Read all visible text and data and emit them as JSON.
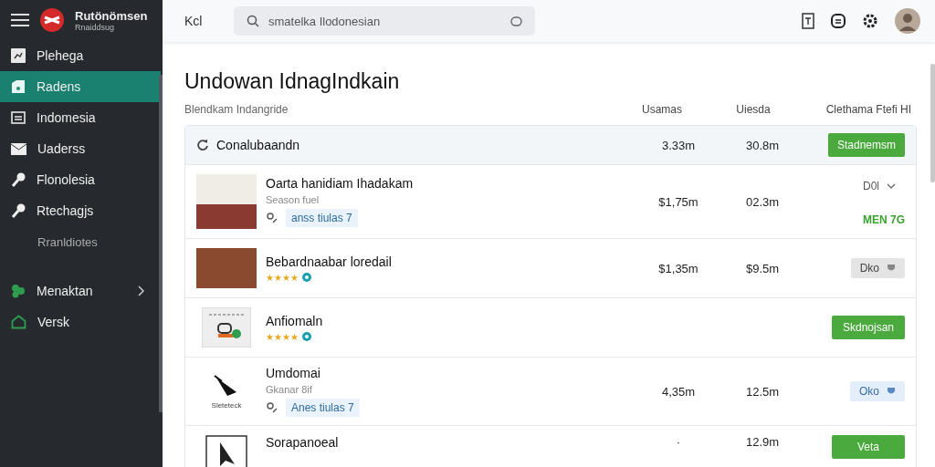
{
  "brand": {
    "name": "Rutönömsen",
    "subtitle": "Rnaiddsug"
  },
  "sidebar": {
    "items": [
      {
        "label": "Plehega",
        "selected": false
      },
      {
        "label": "Radens",
        "selected": true
      },
      {
        "label": "Indomesia",
        "selected": false
      },
      {
        "label": "Uaderss",
        "selected": false
      },
      {
        "label": "Flonolesia",
        "selected": false
      },
      {
        "label": "Rtechagjs",
        "selected": false
      },
      {
        "label": "Rranldiotes",
        "selected": false
      },
      {
        "label": "Menaktan",
        "selected": false,
        "expanded": false
      },
      {
        "label": "Versk",
        "selected": false
      }
    ]
  },
  "topbar": {
    "label": "Kcl",
    "search": {
      "placeholder": "smatelka Ilodonesian"
    }
  },
  "page": {
    "title": "Undowan IdnagIndkain",
    "subtitle": "Blendkam Indangride"
  },
  "columns": [
    "Usamas",
    "Uiesda",
    "Clethama Ftefi HI"
  ],
  "rows": [
    {
      "kind": "summary",
      "title": "Conalubaandn",
      "col1": "3.33m",
      "col2": "30.8m",
      "action": {
        "kind": "button",
        "label": "Stadnemsm"
      }
    },
    {
      "kind": "item",
      "title": "Oarta hanidiam Ihadakam",
      "subtitle": "Season fuel",
      "tag": "anss tiulas 7",
      "col1": "$1,75m",
      "col2": "02.3m",
      "action": {
        "kind": "select",
        "label": "D0l"
      },
      "status": "MEN 7G"
    },
    {
      "kind": "item",
      "title": "Bebardnaabar loredail",
      "stars": 4,
      "col1": "$1,35m",
      "col2": "$9.5m",
      "action": {
        "kind": "chip",
        "label": "Dko"
      }
    },
    {
      "kind": "item",
      "title": "Anfiomaln",
      "stars": 4,
      "action": {
        "kind": "button",
        "label": "Skdnojsan"
      }
    },
    {
      "kind": "item",
      "caption": "Sleteteck",
      "title": "Umdomai",
      "subtitle": "Gkanar 8if",
      "tag": "Anes tiulas 7",
      "col1": "4,35m",
      "col2": "12.5m",
      "action": {
        "kind": "info",
        "label": "Oko"
      }
    },
    {
      "kind": "item",
      "title": "Sorapanoeal",
      "col1": "·",
      "col2": "12.9m",
      "action": {
        "kind": "button",
        "label": "Veta"
      }
    }
  ]
}
